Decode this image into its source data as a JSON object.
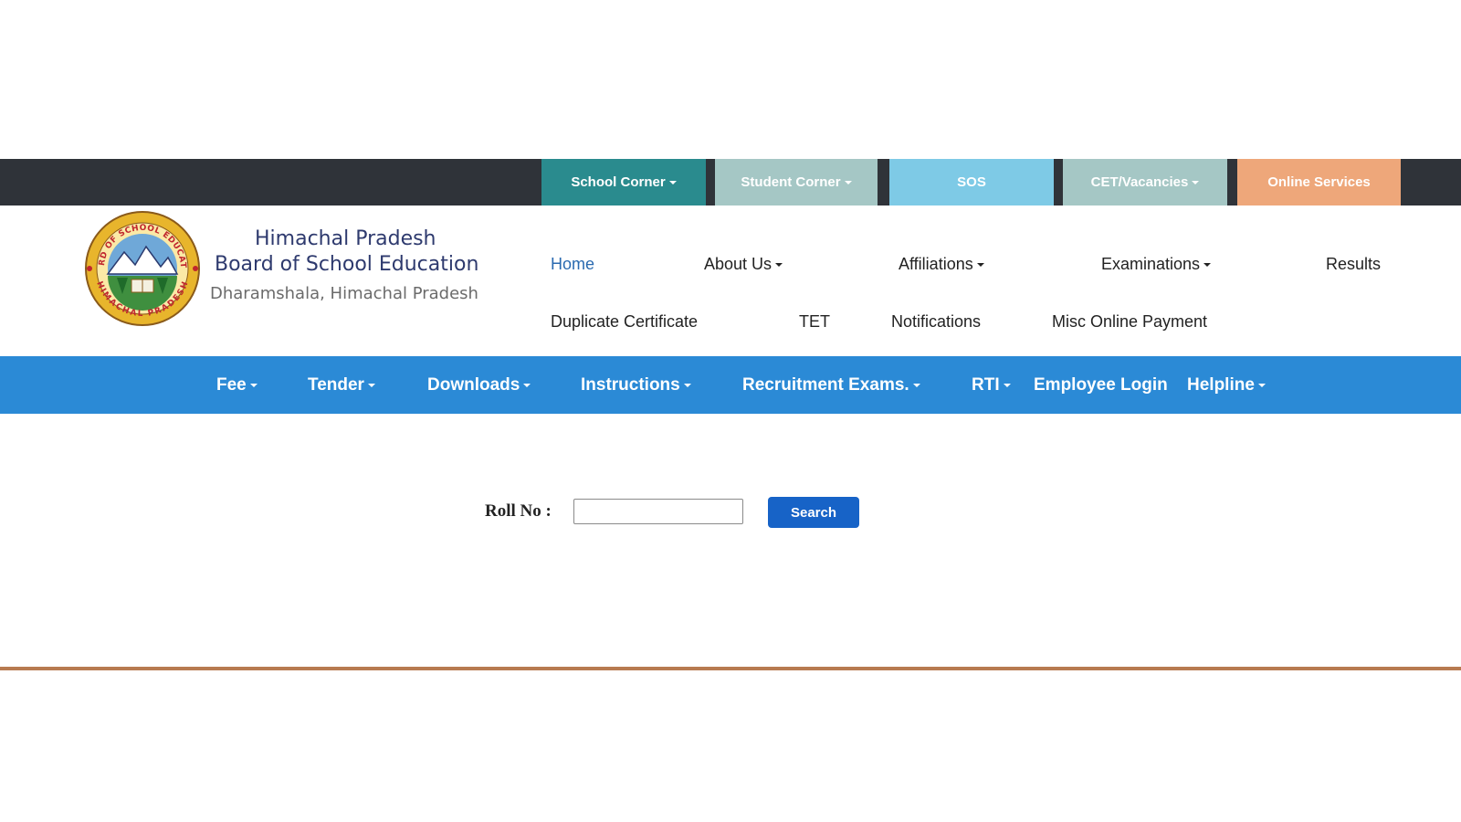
{
  "topbar": {
    "items": [
      {
        "label": "School Corner",
        "dropdown": true,
        "color": "#2a8b8e"
      },
      {
        "label": "Student Corner",
        "dropdown": true,
        "color": "#a5c7c5"
      },
      {
        "label": "SOS",
        "dropdown": false,
        "color": "#7ecae6"
      },
      {
        "label": "CET/Vacancies",
        "dropdown": true,
        "color": "#a5c7c5"
      },
      {
        "label": "Online Services",
        "dropdown": false,
        "color": "#eea77a"
      }
    ]
  },
  "brand": {
    "line1": "Himachal Pradesh",
    "line2": "Board of School Education",
    "line3": "Dharamshala, Himachal Pradesh",
    "logo_text_top": "BOARD OF SCHOOL EDUCATION",
    "logo_text_bottom": "HIMACHAL PRADESH"
  },
  "nav": {
    "row1": [
      {
        "label": "Home",
        "active": true
      },
      {
        "label": "About Us",
        "dropdown": true
      },
      {
        "label": "Affiliations",
        "dropdown": true
      },
      {
        "label": "Examinations",
        "dropdown": true
      },
      {
        "label": "Results"
      }
    ],
    "row2": [
      {
        "label": "Duplicate Certificate"
      },
      {
        "label": "TET"
      },
      {
        "label": "Notifications"
      },
      {
        "label": "Misc Online Payment"
      }
    ]
  },
  "bluebar": {
    "items": [
      {
        "label": "Fee",
        "dropdown": true
      },
      {
        "label": "Tender",
        "dropdown": true
      },
      {
        "label": "Downloads",
        "dropdown": true
      },
      {
        "label": "Instructions",
        "dropdown": true
      },
      {
        "label": "Recruitment Exams.",
        "dropdown": true
      },
      {
        "label": "RTI",
        "dropdown": true
      },
      {
        "label": "Employee Login"
      },
      {
        "label": "Helpline",
        "dropdown": true
      }
    ]
  },
  "search": {
    "label": "Roll No :",
    "value": "",
    "placeholder": "",
    "button": "Search"
  },
  "colors": {
    "topbar_bg": "#2f3339",
    "bluebar_bg": "#2b8ad6",
    "search_button": "#1763c7",
    "divider": "#b77a50",
    "brand_text": "#2e3a6e"
  }
}
